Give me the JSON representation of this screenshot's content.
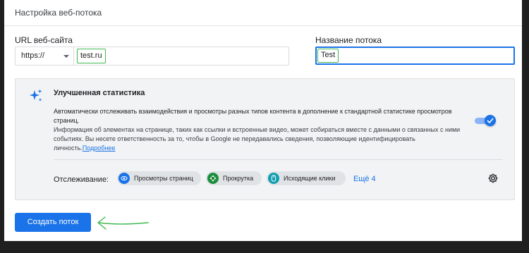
{
  "header": {
    "title": "Настройка веб-потока"
  },
  "form": {
    "url_label": "URL веб-сайта",
    "protocol_value": "https://",
    "url_value": "test.ru",
    "stream_name_label": "Название потока",
    "stream_name_value": "Test"
  },
  "enhanced": {
    "title": "Улучшенная статистика",
    "description": "Автоматически отслеживать взаимодействия и просмотры разных типов контента в дополнение к стандартной статистике просмотров страниц.",
    "details": "Информация об элементах на странице, таких как ссылки и встроенные видео, может собираться вместе с данными о связанных с ними событиях. Вы несете ответственность за то, чтобы в Google не передавались сведения, позволяющие идентифицировать личность.",
    "learn_more": "Подробнее",
    "toggle_on": true,
    "tracking_label": "Отслеживание:",
    "chips": [
      {
        "label": "Просмотры страниц",
        "icon": "eye-icon",
        "color": "#1a73e8"
      },
      {
        "label": "Прокрутка",
        "icon": "scroll-icon",
        "color": "#1e8e3e"
      },
      {
        "label": "Исходящие клики",
        "icon": "mouse-icon",
        "color": "#129eaf"
      }
    ],
    "more_link": "Ещё 4"
  },
  "actions": {
    "create_label": "Создать поток"
  },
  "colors": {
    "accent": "#1a73e8",
    "highlight": "#3fb950",
    "annotation_arrow": "#3fb950"
  }
}
